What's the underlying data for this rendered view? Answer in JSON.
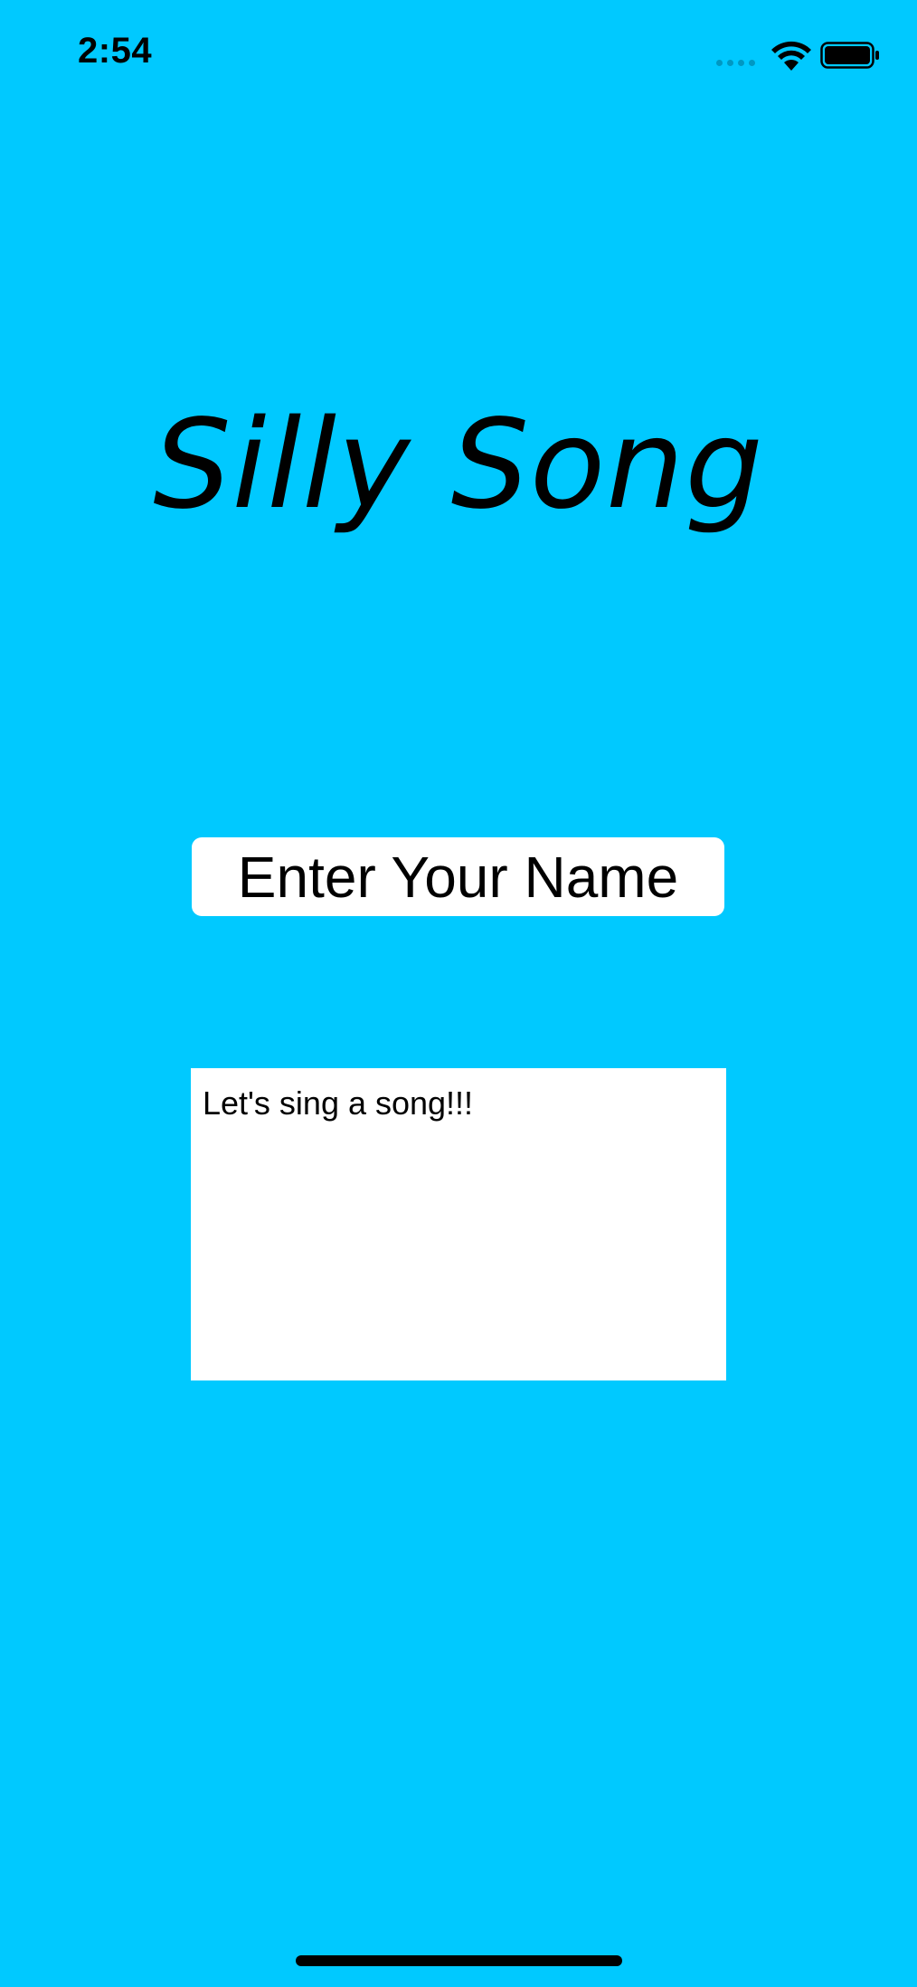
{
  "status_bar": {
    "time": "2:54",
    "signal_icon": "cellular-signal-icon",
    "wifi_icon": "wifi-icon",
    "battery_icon": "battery-icon"
  },
  "app": {
    "title": "Silly Song",
    "background_color": "#00C9FF"
  },
  "name_input": {
    "placeholder": "Enter Your Name",
    "value": ""
  },
  "song_output": {
    "text": "Let's sing a song!!!"
  }
}
